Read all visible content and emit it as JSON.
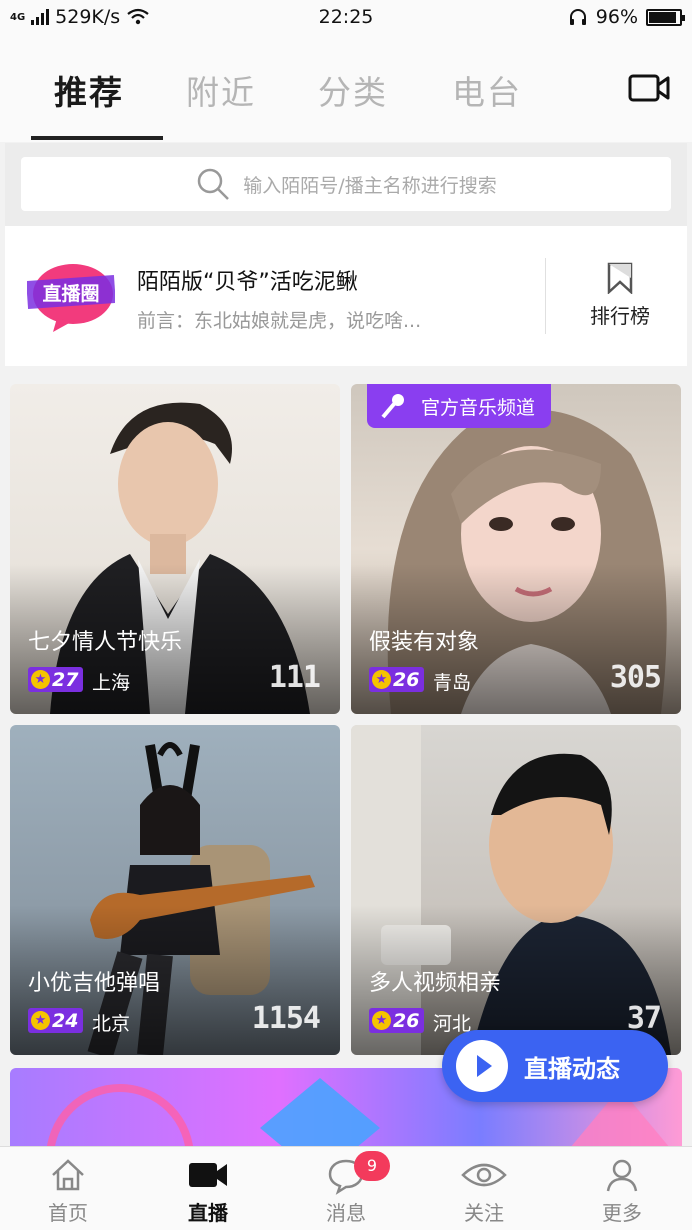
{
  "status_bar": {
    "network": "4G",
    "speed": "529K/s",
    "time": "22:25",
    "battery": "96%",
    "battery_level": 0.96
  },
  "header": {
    "tabs": [
      {
        "label": "推荐",
        "active": true
      },
      {
        "label": "附近",
        "active": false
      },
      {
        "label": "分类",
        "active": false
      },
      {
        "label": "电台",
        "active": false
      }
    ],
    "camera_icon": "video-camera-icon"
  },
  "search": {
    "placeholder": "输入陌陌号/播主名称进行搜索",
    "icon": "search-icon"
  },
  "promo": {
    "logo_text": "直播圈",
    "title": "陌陌版“贝爷”活吃泥鳅",
    "subtitle": "前言：东北姑娘就是虎，说吃啥...",
    "rank_label": "排行榜",
    "rank_icon": "bookmark-icon"
  },
  "cards": [
    {
      "title": "七夕情人节快乐",
      "level": "27",
      "city": "上海",
      "count": "111",
      "tag": ""
    },
    {
      "title": "假装有对象",
      "level": "26",
      "city": "青岛",
      "count": "305",
      "tag": "官方音乐频道"
    },
    {
      "title": "小优吉他弹唱",
      "level": "24",
      "city": "北京",
      "count": "1154",
      "tag": ""
    },
    {
      "title": "多人视频相亲",
      "level": "26",
      "city": "河北",
      "count": "37",
      "tag": ""
    }
  ],
  "live_feed_button": {
    "label": "直播动态",
    "icon": "play-icon"
  },
  "bottom_nav": [
    {
      "label": "首页",
      "icon": "home-icon",
      "active": false,
      "badge": ""
    },
    {
      "label": "直播",
      "icon": "video-camera-icon",
      "active": true,
      "badge": ""
    },
    {
      "label": "消息",
      "icon": "chat-bubble-icon",
      "active": false,
      "badge": "9"
    },
    {
      "label": "关注",
      "icon": "eye-icon",
      "active": false,
      "badge": ""
    },
    {
      "label": "更多",
      "icon": "person-icon",
      "active": false,
      "badge": ""
    }
  ],
  "colors": {
    "accent_purple": "#8a3ef0",
    "live_button_blue": "#3b63f2",
    "badge_red": "#f33a5c",
    "level_badge": "#7b2fe0"
  }
}
